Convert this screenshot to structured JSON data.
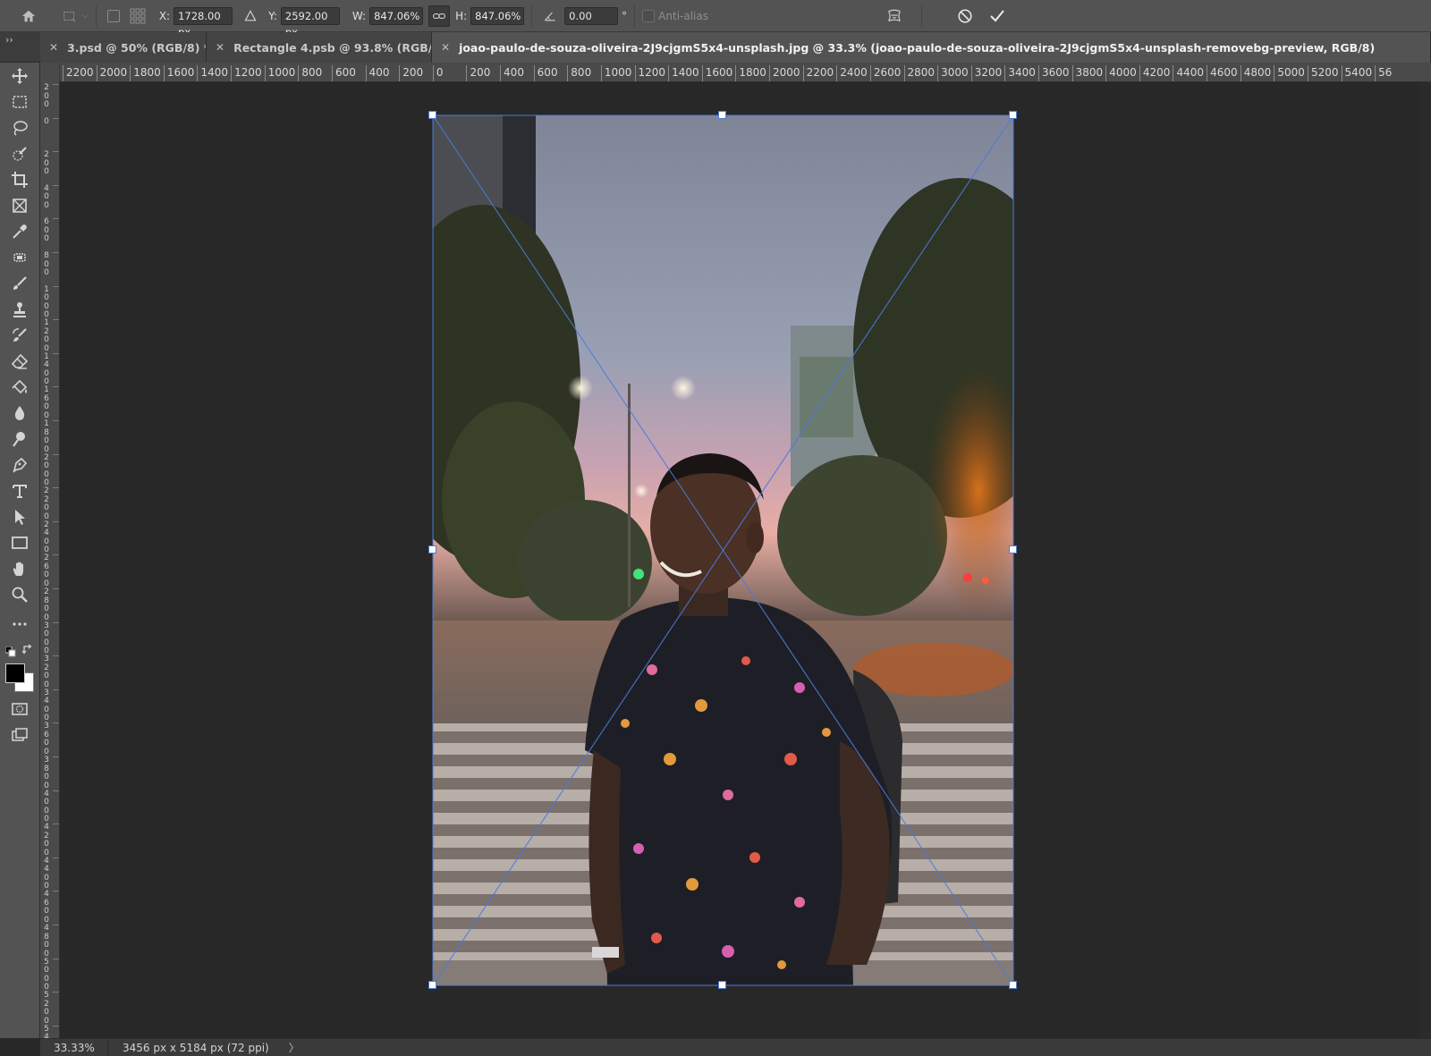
{
  "options_bar": {
    "x_label": "X:",
    "x_value": "1728.00 px",
    "y_label": "Y:",
    "y_value": "2592.00 px",
    "w_label": "W:",
    "w_value": "847.06%",
    "h_label": "H:",
    "h_value": "847.06%",
    "rotate_value": "0.00",
    "degree_symbol": "°",
    "anti_alias_label": "Anti-alias"
  },
  "tabs": [
    {
      "label": "3.psd @ 50% (RGB/8) *",
      "active": false
    },
    {
      "label": "Rectangle 4.psb @ 93.8% (RGB/8)",
      "active": false
    },
    {
      "label": "joao-paulo-de-souza-oliveira-2J9cjgmS5x4-unsplash.jpg @ 33.3% (joao-paulo-de-souza-oliveira-2J9cjgmS5x4-unsplash-removebg-preview, RGB/8)",
      "active": true
    }
  ],
  "ruler_h": [
    "2200",
    "2000",
    "1800",
    "1600",
    "1400",
    "1200",
    "1000",
    "800",
    "600",
    "400",
    "200",
    "0",
    "200",
    "400",
    "600",
    "800",
    "1000",
    "1200",
    "1400",
    "1600",
    "1800",
    "2000",
    "2200",
    "2400",
    "2600",
    "2800",
    "3000",
    "3200",
    "3400",
    "3600",
    "3800",
    "4000",
    "4200",
    "4400",
    "4600",
    "4800",
    "5000",
    "5200",
    "5400",
    "56"
  ],
  "ruler_v": [
    "200",
    "0",
    "200",
    "400",
    "600",
    "800",
    "1000",
    "1200",
    "1400",
    "1600",
    "1800",
    "2000",
    "2200",
    "2400",
    "2600",
    "2800",
    "3000",
    "3200",
    "3400",
    "3600",
    "3800",
    "4000",
    "4200",
    "4400",
    "4600",
    "4800",
    "5000",
    "5200",
    "5400"
  ],
  "status": {
    "zoom": "33.33%",
    "doc_info": "3456 px x 5184 px (72 ppi)",
    "arrow": "〉"
  },
  "colors": {
    "transform_line": "#4a7bd9",
    "foreground": "#000000",
    "background": "#ffffff"
  }
}
